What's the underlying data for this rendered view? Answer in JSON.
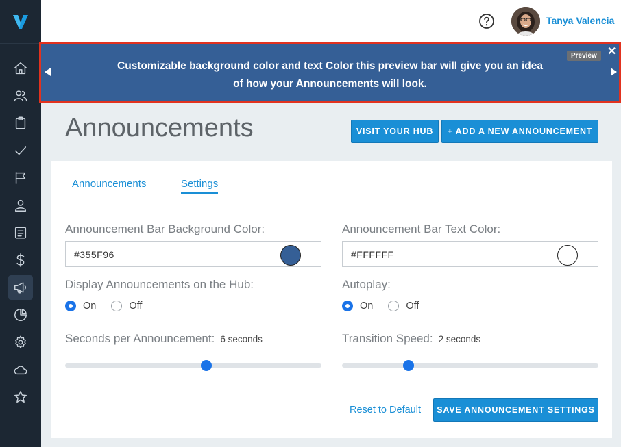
{
  "user": {
    "name": "Tanya Valencia"
  },
  "preview_bar": {
    "line1": "Customizable background color and text Color this preview bar will give you an idea",
    "line2": "of how your Announcements will look.",
    "badge": "Preview",
    "close": "✕",
    "background": "#355F96",
    "text_color": "#FFFFFF"
  },
  "page": {
    "title": "Announcements",
    "visit_hub_label": "VISIT YOUR HUB",
    "add_label": "+ ADD A NEW ANNOUNCEMENT"
  },
  "tabs": [
    {
      "label": "Announcements",
      "active": false
    },
    {
      "label": "Settings",
      "active": true
    }
  ],
  "settings": {
    "bg_color_label": "Announcement Bar Background Color:",
    "bg_color_value": "#355F96",
    "text_color_label": "Announcement Bar Text Color:",
    "text_color_value": "#FFFFFF",
    "display_label": "Display Announcements on the Hub:",
    "autoplay_label": "Autoplay:",
    "on_label": "On",
    "off_label": "Off",
    "display_selected": "On",
    "autoplay_selected": "On",
    "seconds_label": "Seconds per Announcement:",
    "seconds_value": "6 seconds",
    "seconds_slider_fraction": 0.55,
    "transition_label": "Transition Speed:",
    "transition_value": "2 seconds",
    "transition_slider_fraction": 0.26
  },
  "actions": {
    "reset_label": "Reset to Default",
    "save_label": "SAVE ANNOUNCEMENT SETTINGS"
  },
  "sidebar_icons": [
    "home-icon",
    "users-icon",
    "clipboard-icon",
    "check-icon",
    "flag-icon",
    "person-icon",
    "document-icon",
    "dollar-icon",
    "megaphone-icon",
    "pie-chart-icon",
    "gear-icon",
    "cloud-icon",
    "star-icon"
  ],
  "colors": {
    "accent": "#1a8fd6",
    "sidebar": "#1c2733",
    "radio": "#1a73e8"
  }
}
